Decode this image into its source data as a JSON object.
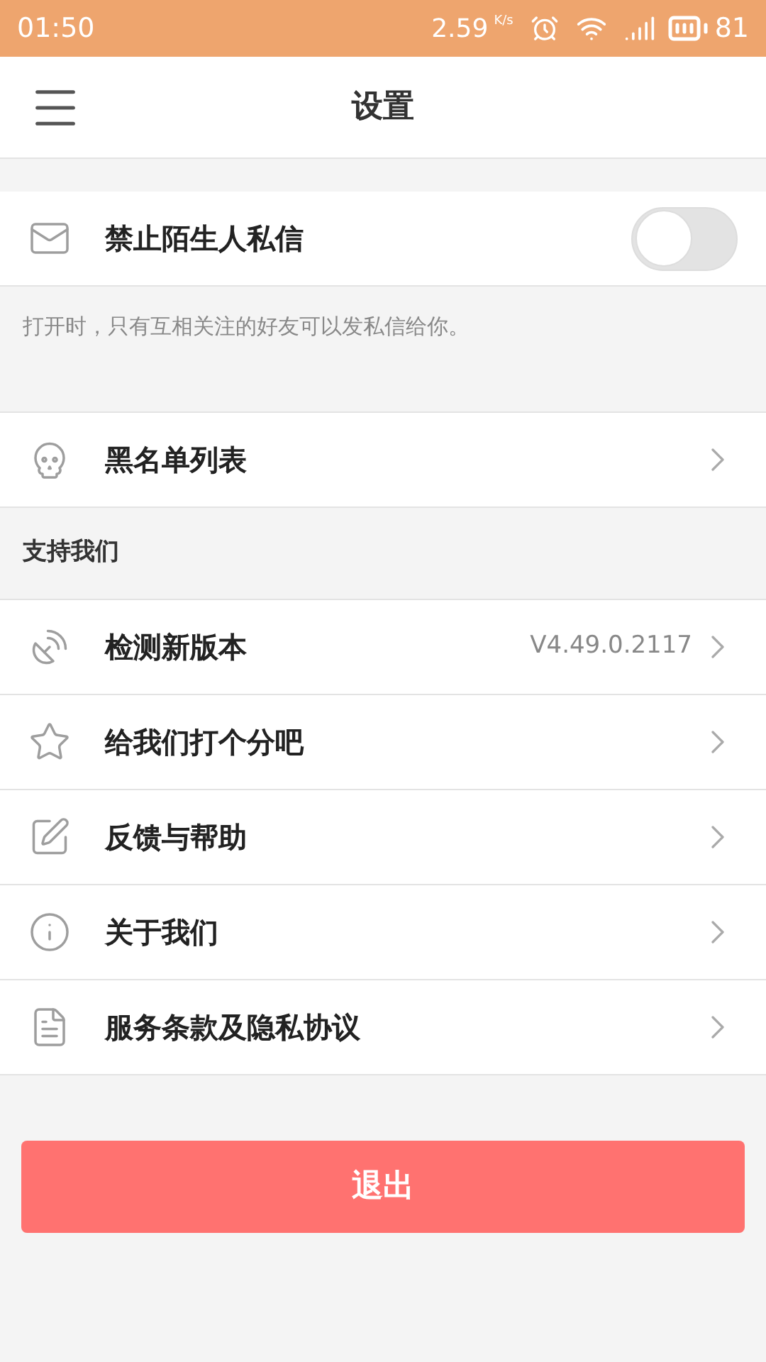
{
  "status_bar": {
    "time": "01:50",
    "speed": "2.59",
    "speed_unit": "K/s",
    "battery": "81"
  },
  "header": {
    "title": "设置"
  },
  "privacy": {
    "label": "禁止陌生人私信",
    "on": false,
    "hint": "打开时，只有互相关注的好友可以发私信给你。"
  },
  "blacklist": {
    "label": "黑名单列表"
  },
  "support": {
    "heading": "支持我们",
    "items": [
      {
        "label": "检测新版本",
        "value": "V4.49.0.2117"
      },
      {
        "label": "给我们打个分吧"
      },
      {
        "label": "反馈与帮助"
      },
      {
        "label": "关于我们"
      },
      {
        "label": "服务条款及隐私协议"
      }
    ]
  },
  "logout_button": "退出"
}
